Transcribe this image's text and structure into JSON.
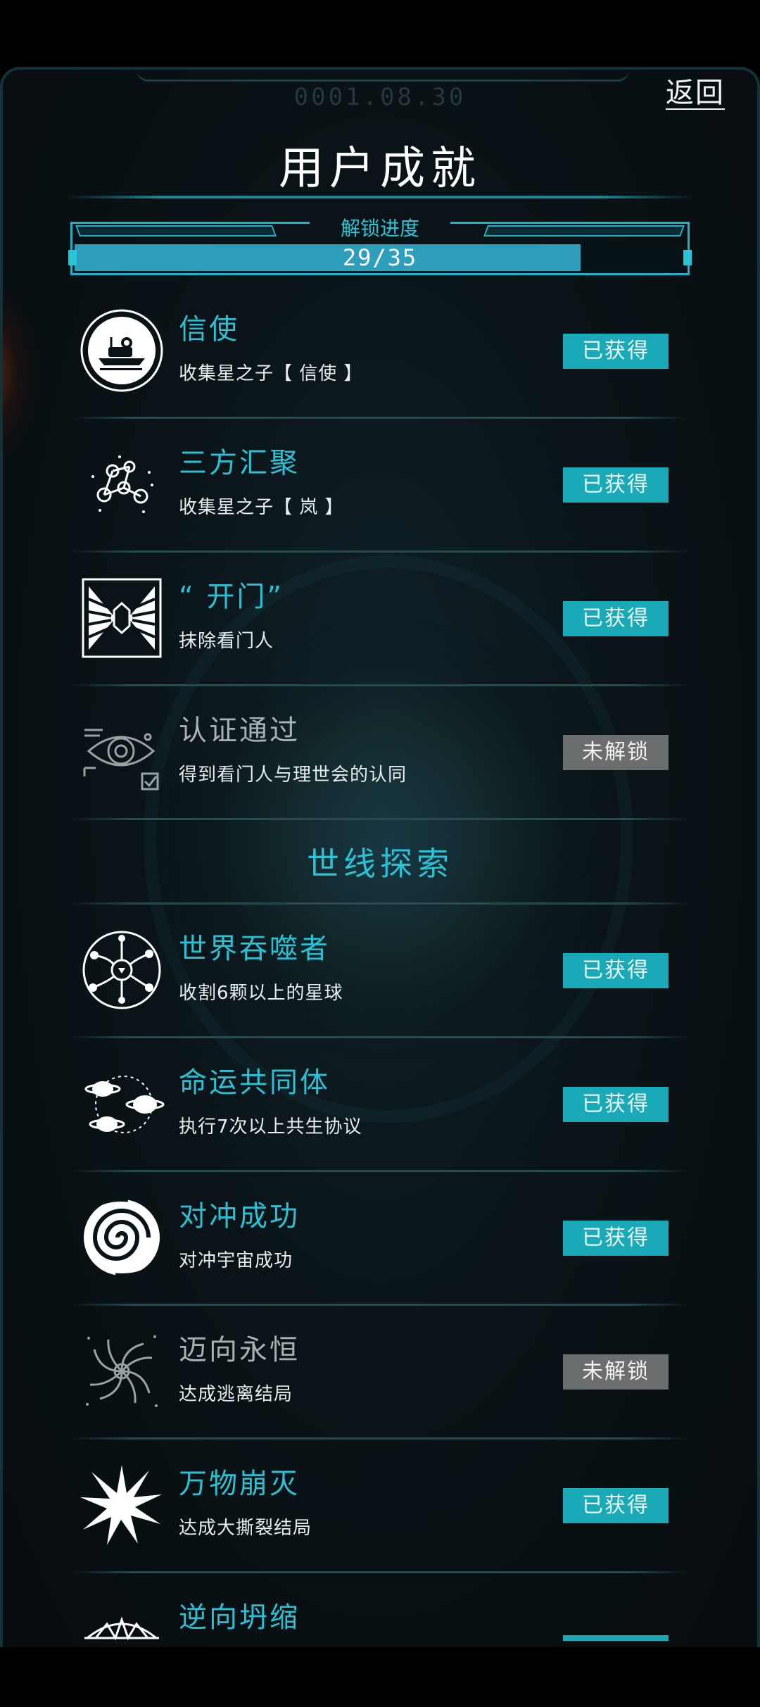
{
  "header": {
    "date": "0001.08.30",
    "back_label": "返回",
    "title": "用户成就"
  },
  "progress": {
    "label": "解锁进度",
    "text": "29/35",
    "unlocked": 29,
    "total": 35
  },
  "colors": {
    "accent": "#2cc0d3",
    "badge_obtained": "#1aa9b6",
    "badge_locked": "#6a6e6f"
  },
  "achievements_top": [
    {
      "name": "信使",
      "desc": "收集星之子【 信使 】",
      "status": "已获得",
      "icon": "spaceship-icon"
    },
    {
      "name": "三方汇聚",
      "desc": "收集星之子【 岚 】",
      "status": "已获得",
      "icon": "constellation-icon"
    },
    {
      "name": "“ 开门”",
      "desc": "抹除看门人",
      "status": "已获得",
      "icon": "gate-icon"
    },
    {
      "name": "认证通过",
      "desc": "得到看门人与理世会的认同",
      "status": "未解锁",
      "icon": "eye-check-icon"
    }
  ],
  "section": {
    "title": "世线探索"
  },
  "achievements_world": [
    {
      "name": "世界吞噬者",
      "desc": "收割6颗以上的星球",
      "status": "已获得",
      "icon": "orbit-network-icon"
    },
    {
      "name": "命运共同体",
      "desc": "执行7次以上共生协议",
      "status": "已获得",
      "icon": "planets-link-icon"
    },
    {
      "name": "对冲成功",
      "desc": "对冲宇宙成功",
      "status": "已获得",
      "icon": "vortex-icon"
    },
    {
      "name": "迈向永恒",
      "desc": "达成逃离结局",
      "status": "未解锁",
      "icon": "spiral-galaxy-icon"
    },
    {
      "name": "万物崩灭",
      "desc": "达成大撕裂结局",
      "status": "已获得",
      "icon": "starburst-icon"
    },
    {
      "name": "逆向坍缩",
      "desc": "",
      "status": "",
      "icon": "collapse-icon"
    }
  ]
}
